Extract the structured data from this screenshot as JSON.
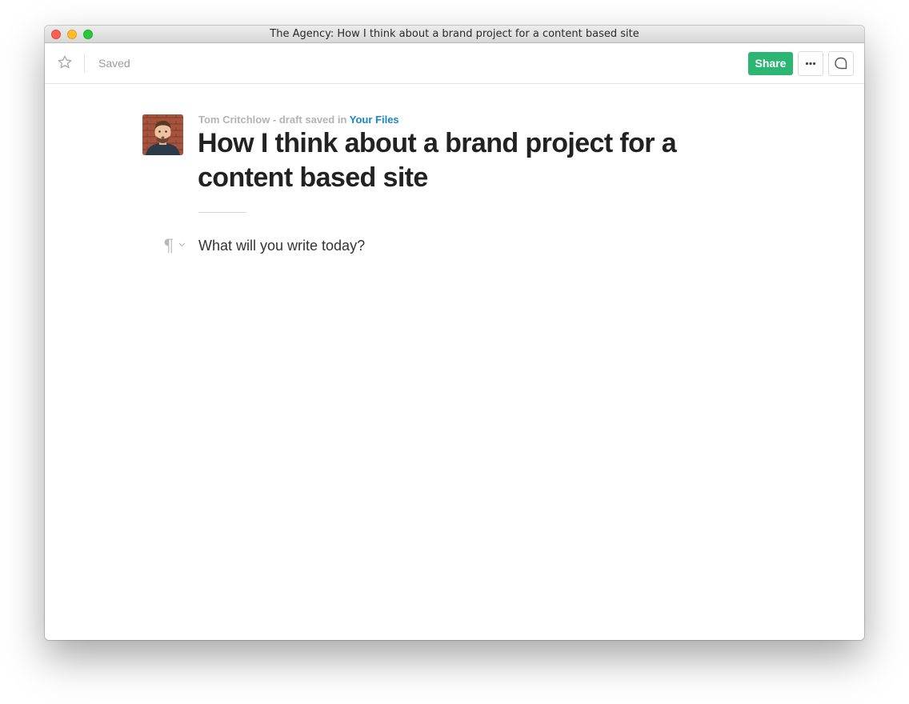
{
  "window": {
    "title": "The Agency: How I think about a brand project for a content based site"
  },
  "toolbar": {
    "star_icon": "star-outline-icon",
    "saved_label": "Saved",
    "share_label": "Share",
    "more_icon": "ellipsis-icon",
    "comment_icon": "comment-bubble-icon"
  },
  "document": {
    "author": "Tom Critchlow",
    "status_text": " - draft saved in ",
    "folder_link": "Your Files",
    "title": "How I think about a brand project for a content based site",
    "body_placeholder": "What will you write today?",
    "paragraph_style_icon": "pilcrow-icon"
  },
  "colors": {
    "accent_green": "#2bb673",
    "link_blue": "#1a86c8",
    "meta_gray": "#b3b3b3",
    "title_text": "#222222"
  }
}
